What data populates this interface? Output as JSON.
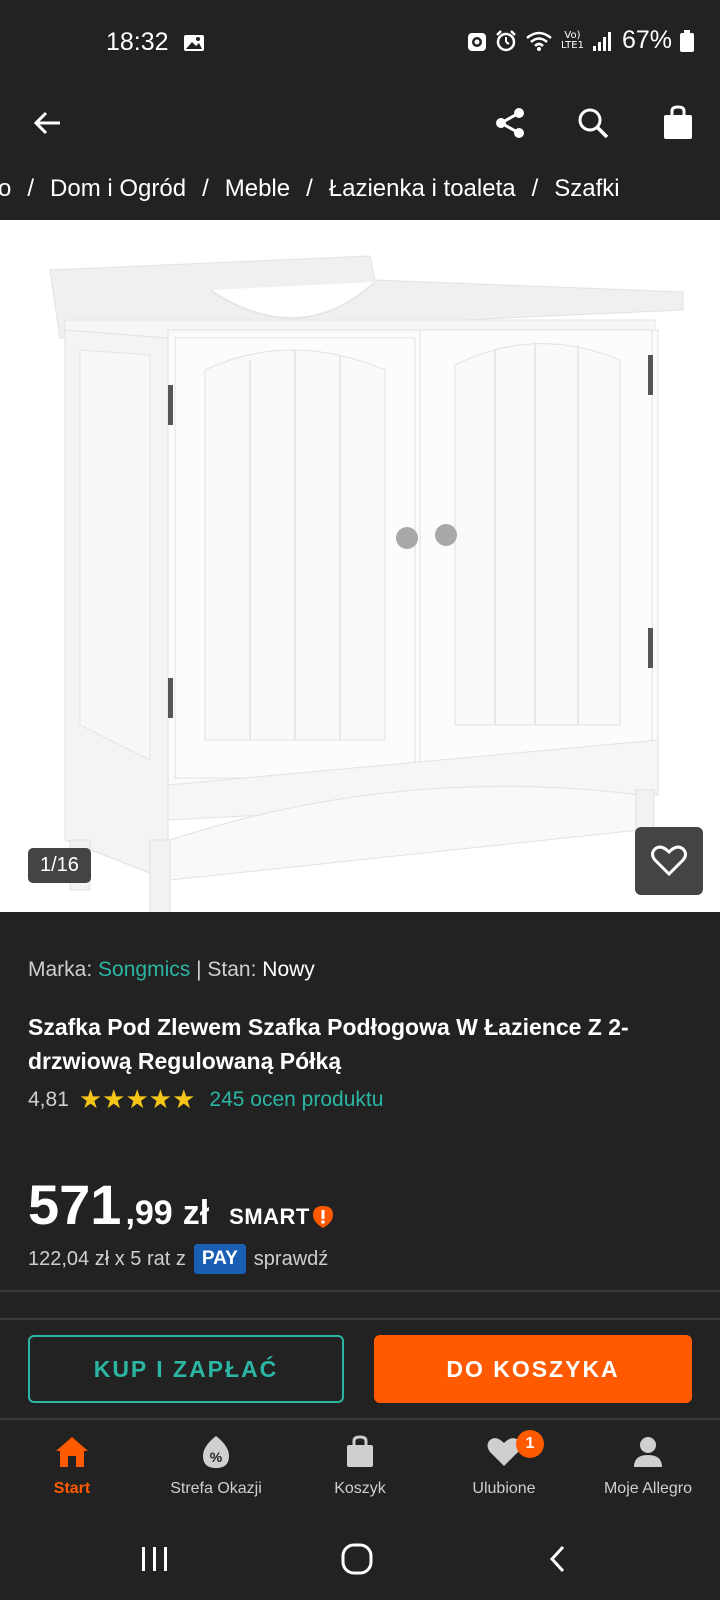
{
  "status_bar": {
    "time": "18:32",
    "network_top": "Vo)",
    "network_bottom": "LTE1",
    "battery": "67%"
  },
  "breadcrumb": [
    "ro",
    "Dom i Ogród",
    "Meble",
    "Łazienka i toaleta",
    "Szafki"
  ],
  "gallery": {
    "counter": "1/16"
  },
  "product": {
    "brand_label": "Marka:",
    "brand": "Songmics",
    "separator": "|",
    "condition_label": "Stan:",
    "condition": "Nowy",
    "title": "Szafka Pod Zlewem Szafka Podłogowa W Łazience Z 2-drzwiową Regulowaną Półką",
    "rating": "4,81",
    "stars": "★★★★★",
    "rating_count": "245 ocen produktu"
  },
  "price": {
    "integer": "571",
    "decimal": ",99",
    "currency": "zł",
    "smart_label": "SMART"
  },
  "installments": {
    "text": "122,04 zł x 5 rat z",
    "pay_label": "PAY",
    "check": "sprawdź"
  },
  "actions": {
    "buy_now": "KUP I ZAPŁAĆ",
    "add_to_cart": "DO KOSZYKA"
  },
  "bottom_nav": {
    "items": [
      {
        "label": "Start",
        "icon": "home-icon",
        "active": true
      },
      {
        "label": "Strefa Okazji",
        "icon": "deals-icon",
        "active": false
      },
      {
        "label": "Koszyk",
        "icon": "cart-icon",
        "active": false
      },
      {
        "label": "Ulubione",
        "icon": "heart-icon",
        "active": false,
        "badge": "1"
      },
      {
        "label": "Moje Allegro",
        "icon": "user-icon",
        "active": false
      }
    ]
  },
  "colors": {
    "accent_orange": "#ff5a00",
    "accent_teal": "#2bb5a3",
    "background": "#222222",
    "star": "#f5c518"
  }
}
